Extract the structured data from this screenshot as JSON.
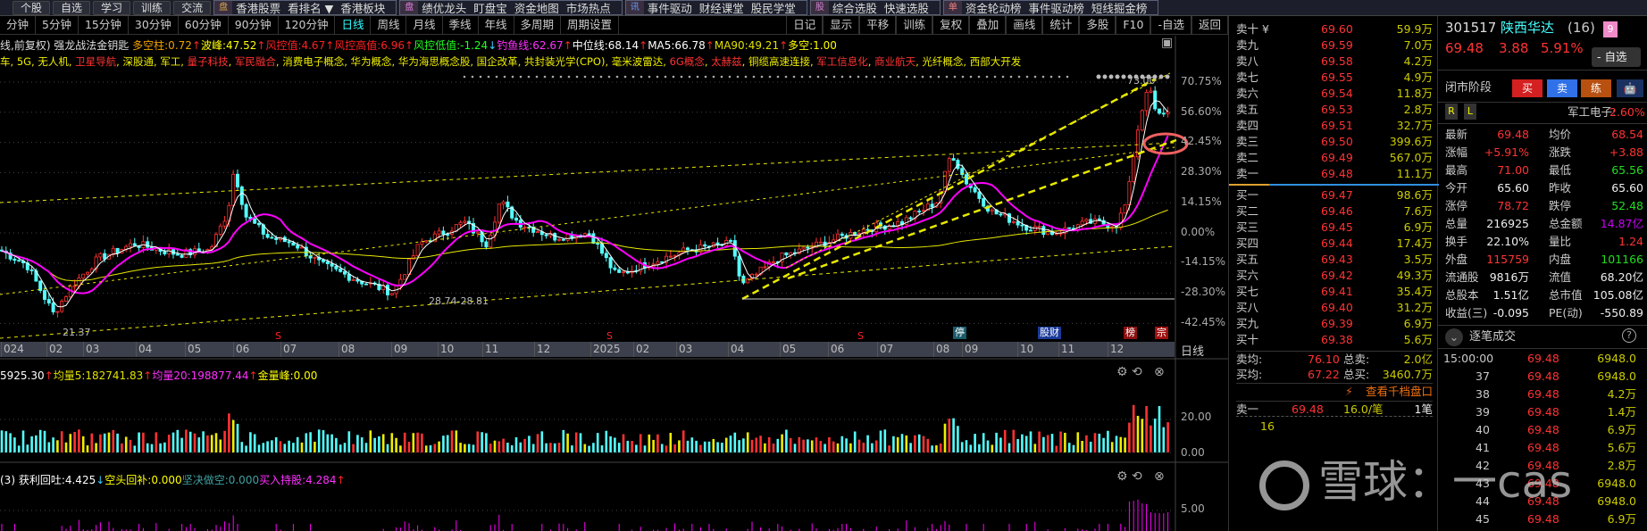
{
  "toolbar": {
    "left_buttons": [
      "个股",
      "自选",
      "学习",
      "训练",
      "交流"
    ],
    "groups": [
      {
        "icon": "盘",
        "icon_color": "#d8a84a",
        "items": [
          "香港股票",
          "看排名 ▼",
          "香港板块"
        ]
      },
      {
        "icon": "盘",
        "icon_color": "#e080e0",
        "items": [
          "绩优龙头",
          "盯盘宝",
          "资金地图",
          "市场热点"
        ]
      },
      {
        "icon": "讯",
        "icon_color": "#6aa0ff",
        "items": [
          "事件驱动",
          "财经课堂",
          "股民学堂"
        ]
      },
      {
        "icon": "股",
        "icon_color": "#d080d0",
        "items": [
          "综合选股",
          "快速选股"
        ]
      },
      {
        "icon": "单",
        "icon_color": "#f08080",
        "items": [
          "资金轮动榜",
          "事件驱动榜",
          "短线掘金榜"
        ]
      }
    ]
  },
  "periods": [
    "分钟",
    "5分钟",
    "15分钟",
    "30分钟",
    "60分钟",
    "90分钟",
    "120分钟",
    "日线",
    "周线",
    "月线",
    "季线",
    "年线",
    "多周期",
    "周期设置"
  ],
  "active_period": "日线",
  "chart_tools": [
    "日记",
    "显示",
    "平移",
    "训练",
    "复权",
    "叠加",
    "画线",
    "统计",
    "多股",
    "F10",
    "-自选",
    "返回"
  ],
  "legend": {
    "title": "线,前复权) 强龙战法金钥匙",
    "items": [
      {
        "text": "多空柱:0.72",
        "color": "#f0a000",
        "arrow": "↑"
      },
      {
        "text": "波峰:47.52",
        "color": "#ffff00",
        "arrow": "↑"
      },
      {
        "text": "风控值:4.67",
        "color": "#ff2020",
        "arrow": "↑"
      },
      {
        "text": "风控高值:6.96",
        "color": "#ff2020",
        "arrow": "↑"
      },
      {
        "text": "风控低值:-1.24",
        "color": "#20ff20",
        "arrow": "↓"
      },
      {
        "text": "钓鱼线:62.67",
        "color": "#ff30ff",
        "arrow": "↑"
      },
      {
        "text": "中位线:68.14",
        "color": "#ffffff",
        "arrow": "↑"
      },
      {
        "text": "MA5:66.78",
        "color": "#ffffff",
        "arrow": "↑"
      },
      {
        "text": "MA90:49.21",
        "color": "#e0e000",
        "arrow": "↑"
      },
      {
        "text": "多空:1.00",
        "color": "#ffff00",
        "arrow": ""
      }
    ]
  },
  "concepts": [
    {
      "t": "车",
      "hot": false
    },
    {
      "t": "5G",
      "hot": false
    },
    {
      "t": "无人机",
      "hot": false
    },
    {
      "t": "卫星导航",
      "hot": true
    },
    {
      "t": "深股通",
      "hot": false
    },
    {
      "t": "军工",
      "hot": false
    },
    {
      "t": "量子科技",
      "hot": true
    },
    {
      "t": "军民融合",
      "hot": true
    },
    {
      "t": "消费电子概念",
      "hot": false
    },
    {
      "t": "华为概念",
      "hot": false
    },
    {
      "t": "华为海思概念股",
      "hot": false
    },
    {
      "t": "国企改革",
      "hot": false
    },
    {
      "t": "共封装光学(CPO)",
      "hot": false
    },
    {
      "t": "毫米波雷达",
      "hot": false
    },
    {
      "t": "6G概念",
      "hot": true
    },
    {
      "t": "太赫兹",
      "hot": true
    },
    {
      "t": "铜缆高速连接",
      "hot": false
    },
    {
      "t": "军工信息化",
      "hot": true
    },
    {
      "t": "商业航天",
      "hot": true
    },
    {
      "t": "光纤概念",
      "hot": false
    },
    {
      "t": "西部大开发",
      "hot": false
    }
  ],
  "price_axis": [
    "70.75%",
    "56.60%",
    "42.45%",
    "28.30%",
    "14.15%",
    "0.00%",
    "-14.15%",
    "-28.30%",
    "-42.45%"
  ],
  "annotations": {
    "high": "73.00",
    "low_range": "28.74-28.81",
    "low": "21.37"
  },
  "x_axis": {
    "months": [
      "024",
      "02",
      "03",
      "04",
      "05",
      "06",
      "07",
      "08",
      "09",
      "10",
      "11",
      "12",
      "2025",
      "02",
      "03",
      "04",
      "05",
      "06",
      "07",
      "08",
      "09",
      "10",
      "11",
      "12"
    ],
    "label": "日线"
  },
  "event_marks": [
    "S",
    "S",
    "S",
    "停",
    "股财",
    "榜",
    "宗"
  ],
  "volume": {
    "header": [
      {
        "text": "5925.30",
        "color": "#ffffff",
        "arrow": "↑"
      },
      {
        "text": "均量5:182741.83",
        "color": "#e0e000",
        "arrow": "↑"
      },
      {
        "text": "均量20:198877.44",
        "color": "#ff30ff",
        "arrow": "↑"
      },
      {
        "text": "金量峰:0.00",
        "color": "#ffff00",
        "arrow": ""
      }
    ],
    "axis": [
      "20.00",
      "0.00"
    ]
  },
  "indicator": {
    "header": [
      {
        "text": "(3) 获利回吐:4.425",
        "color": "#ffffff",
        "arrow": "↓"
      },
      {
        "text": "空头回补:0.000",
        "color": "#ffff00",
        "arrow": ""
      },
      {
        "text": "坚决做空:0.000",
        "color": "#40a0a0",
        "arrow": ""
      },
      {
        "text": "买入持股:4.284",
        "color": "#ff30ff",
        "arrow": "↑"
      }
    ],
    "axis": [
      "5.00"
    ]
  },
  "order_book": {
    "asks": [
      {
        "label": "卖十 ¥",
        "price": "69.60",
        "vol": "59.9万"
      },
      {
        "label": "卖九",
        "price": "69.59",
        "vol": "7.0万"
      },
      {
        "label": "卖八",
        "price": "69.58",
        "vol": "4.2万"
      },
      {
        "label": "卖七",
        "price": "69.55",
        "vol": "4.9万"
      },
      {
        "label": "卖六",
        "price": "69.54",
        "vol": "11.8万"
      },
      {
        "label": "卖五",
        "price": "69.53",
        "vol": "2.8万"
      },
      {
        "label": "卖四",
        "price": "69.51",
        "vol": "32.7万"
      },
      {
        "label": "卖三",
        "price": "69.50",
        "vol": "399.6万"
      },
      {
        "label": "卖二",
        "price": "69.49",
        "vol": "567.0万"
      },
      {
        "label": "卖一",
        "price": "69.48",
        "vol": "11.1万"
      }
    ],
    "bids": [
      {
        "label": "买一",
        "price": "69.47",
        "vol": "98.6万"
      },
      {
        "label": "买二",
        "price": "69.46",
        "vol": "7.6万"
      },
      {
        "label": "买三",
        "price": "69.45",
        "vol": "6.9万"
      },
      {
        "label": "买四",
        "price": "69.44",
        "vol": "17.4万"
      },
      {
        "label": "买五",
        "price": "69.43",
        "vol": "3.5万"
      },
      {
        "label": "买六",
        "price": "69.42",
        "vol": "49.3万"
      },
      {
        "label": "买七",
        "price": "69.41",
        "vol": "35.4万"
      },
      {
        "label": "买八",
        "price": "69.40",
        "vol": "31.2万"
      },
      {
        "label": "买九",
        "price": "69.39",
        "vol": "6.9万"
      },
      {
        "label": "买十",
        "price": "69.38",
        "vol": "5.6万"
      }
    ],
    "sell_avg_label": "卖均:",
    "sell_avg": "76.10",
    "total_sell_label": "总卖:",
    "total_sell": "2.0亿",
    "buy_avg_label": "买均:",
    "buy_avg": "67.22",
    "total_buy_label": "总买:",
    "total_buy": "3460.7万",
    "depth_link": "查看千档盘口",
    "queue": {
      "label": "卖一",
      "price": "69.48",
      "per": "16.0/笔",
      "count": "1笔",
      "first": "16"
    }
  },
  "stock": {
    "code": "301517",
    "name": "陕西华达",
    "count": "(16)",
    "badge": "9",
    "price": "69.48",
    "change": "3.88",
    "pct": "5.91%",
    "watch": "- 自选",
    "status": "闭市阶段",
    "buy": "买",
    "sell": "卖",
    "practice": "练",
    "sector": "军工电子:",
    "sector_pct": "2.60%",
    "r": "R",
    "l": "L"
  },
  "stats": [
    {
      "k": "最新",
      "v": "69.48",
      "c": "red",
      "k2": "均价",
      "v2": "68.54",
      "c2": "red"
    },
    {
      "k": "涨幅",
      "v": "+5.91%",
      "c": "red",
      "k2": "涨跌",
      "v2": "+3.88",
      "c2": "red"
    },
    {
      "k": "最高",
      "v": "71.00",
      "c": "red",
      "k2": "最低",
      "v2": "65.56",
      "c2": "grn"
    },
    {
      "k": "今开",
      "v": "65.60",
      "c": "wht",
      "k2": "昨收",
      "v2": "65.60",
      "c2": "wht"
    },
    {
      "k": "涨停",
      "v": "78.72",
      "c": "red",
      "k2": "跌停",
      "v2": "52.48",
      "c2": "grn"
    },
    {
      "k": "总量",
      "v": "216925",
      "c": "wht",
      "k2": "总金额",
      "v2": "14.87亿",
      "c2": "mag"
    },
    {
      "k": "换手",
      "v": "22.10%",
      "c": "wht",
      "k2": "量比",
      "v2": "1.24",
      "c2": "red"
    },
    {
      "k": "外盘",
      "v": "115759",
      "c": "red",
      "k2": "内盘",
      "v2": "101166",
      "c2": "grn"
    },
    {
      "k": "流通股",
      "v": "9816万",
      "c": "wht",
      "k2": "流值",
      "v2": "68.20亿",
      "c2": "wht"
    },
    {
      "k": "总股本",
      "v": "1.51亿",
      "c": "wht",
      "k2": "总市值",
      "v2": "105.08亿",
      "c2": "wht"
    },
    {
      "k": "收益(三)",
      "v": "-0.095",
      "c": "wht",
      "k2": "PE(动)",
      "v2": "-550.89",
      "c2": "wht"
    }
  ],
  "ticks_title": "逐笔成交",
  "ticks": [
    {
      "t": "15:00:00",
      "p": "69.48",
      "v": "6948.0"
    },
    {
      "t": "37",
      "p": "69.48",
      "v": "6948.0"
    },
    {
      "t": "38",
      "p": "69.48",
      "v": "4.2万"
    },
    {
      "t": "39",
      "p": "69.48",
      "v": "1.4万"
    },
    {
      "t": "40",
      "p": "69.48",
      "v": "6.9万"
    },
    {
      "t": "41",
      "p": "69.48",
      "v": "5.6万"
    },
    {
      "t": "42",
      "p": "69.48",
      "v": "2.8万"
    },
    {
      "t": "43",
      "p": "69.48",
      "v": "6948.0"
    },
    {
      "t": "44",
      "p": "69.48",
      "v": "6948.0"
    },
    {
      "t": "45",
      "p": "69.48",
      "v": "6.9万"
    }
  ],
  "watermark": "雪球：一cas",
  "colors": {
    "up": "#ff3232",
    "down": "#54ffff",
    "ma_fast": "#ff00ff",
    "ma_slow": "#e8e800",
    "trend": "#e8e800",
    "bg": "#000000"
  }
}
